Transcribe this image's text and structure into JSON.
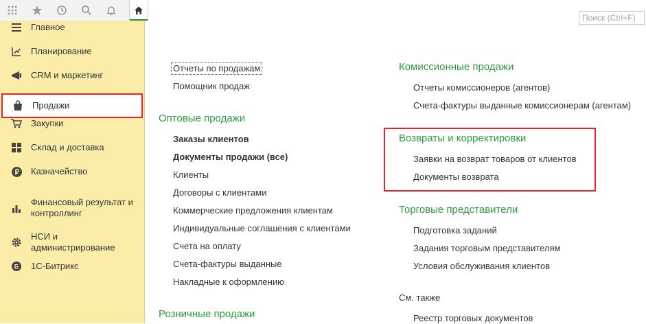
{
  "toolbar": {
    "icons": [
      "apps-grid-icon",
      "star-icon",
      "history-icon",
      "search-icon",
      "bell-icon",
      "home-icon"
    ],
    "search": {
      "placeholder": "Поиск (Ctrl+F)",
      "value": ""
    }
  },
  "sidebar": {
    "items": [
      {
        "label": "Главное",
        "icon": "menu-lines-icon"
      },
      {
        "label": "Планирование",
        "icon": "planning-icon"
      },
      {
        "label": "CRM и маркетинг",
        "icon": "crm-icon"
      },
      {
        "label": "Продажи",
        "icon": "shopping-bag-icon",
        "active": true
      },
      {
        "label": "Закупки",
        "icon": "cart-icon"
      },
      {
        "label": "Склад и доставка",
        "icon": "warehouse-icon"
      },
      {
        "label": "Казначейство",
        "icon": "ruble-icon"
      },
      {
        "label": "Финансовый результат и контроллинг",
        "icon": "bar-chart-icon"
      },
      {
        "label": "НСИ и администрирование",
        "icon": "gear-icon"
      },
      {
        "label": "1С-Битрикс",
        "icon": "bitrix-icon"
      }
    ]
  },
  "left_column": {
    "top_links": [
      "Отчеты по продажам",
      "Помощник продаж"
    ],
    "wholesale": {
      "title": "Оптовые продажи",
      "links": [
        "Заказы клиентов",
        "Документы продажи (все)",
        "Клиенты",
        "Договоры с клиентами",
        "Коммерческие предложения клиентам",
        "Индивидуальные соглашения с клиентами",
        "Счета на оплату",
        "Счета-фактуры выданные",
        "Накладные к оформлению"
      ]
    },
    "retail": {
      "title": "Розничные продажи"
    }
  },
  "right_column": {
    "commission": {
      "title": "Комиссионные продажи",
      "links": [
        "Отчеты комиссионеров (агентов)",
        "Счета-фактуры выданные комиссионерам (агентам)"
      ]
    },
    "returns": {
      "title": "Возвраты и корректировки",
      "links": [
        "Заявки на возврат товаров от клиентов",
        "Документы возврата"
      ]
    },
    "trade_reps": {
      "title": "Торговые представители",
      "links": [
        "Подготовка заданий",
        "Задания торговым представителям",
        "Условия обслуживания клиентов"
      ]
    },
    "see_also": {
      "title": "См. также",
      "links": [
        "Реестр торговых документов"
      ]
    }
  },
  "colors": {
    "accent_green": "#2f9a3e",
    "sidebar_bg": "#fbeda8",
    "highlight_red": "#e0262f"
  }
}
